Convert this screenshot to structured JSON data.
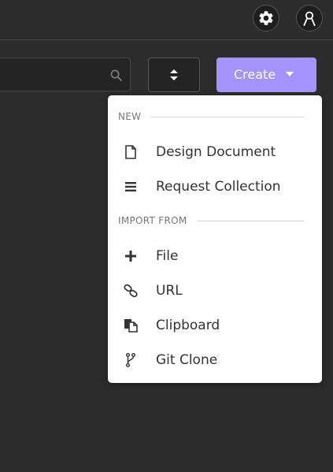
{
  "header": {
    "settings_icon": "gear-icon",
    "account_icon": "user-icon"
  },
  "toolbar": {
    "search_placeholder": "",
    "search_icon": "search-icon",
    "sort_icon": "sort-icon",
    "create_label": "Create",
    "create_color": "#a593ff"
  },
  "menu": {
    "sections": [
      {
        "title": "NEW",
        "items": [
          {
            "label": "Design Document",
            "icon": "document-icon"
          },
          {
            "label": "Request Collection",
            "icon": "bars-icon"
          }
        ]
      },
      {
        "title": "IMPORT FROM",
        "items": [
          {
            "label": "File",
            "icon": "plus-icon"
          },
          {
            "label": "URL",
            "icon": "link-icon"
          },
          {
            "label": "Clipboard",
            "icon": "clipboard-icon"
          },
          {
            "label": "Git Clone",
            "icon": "git-branch-icon"
          }
        ]
      }
    ]
  }
}
